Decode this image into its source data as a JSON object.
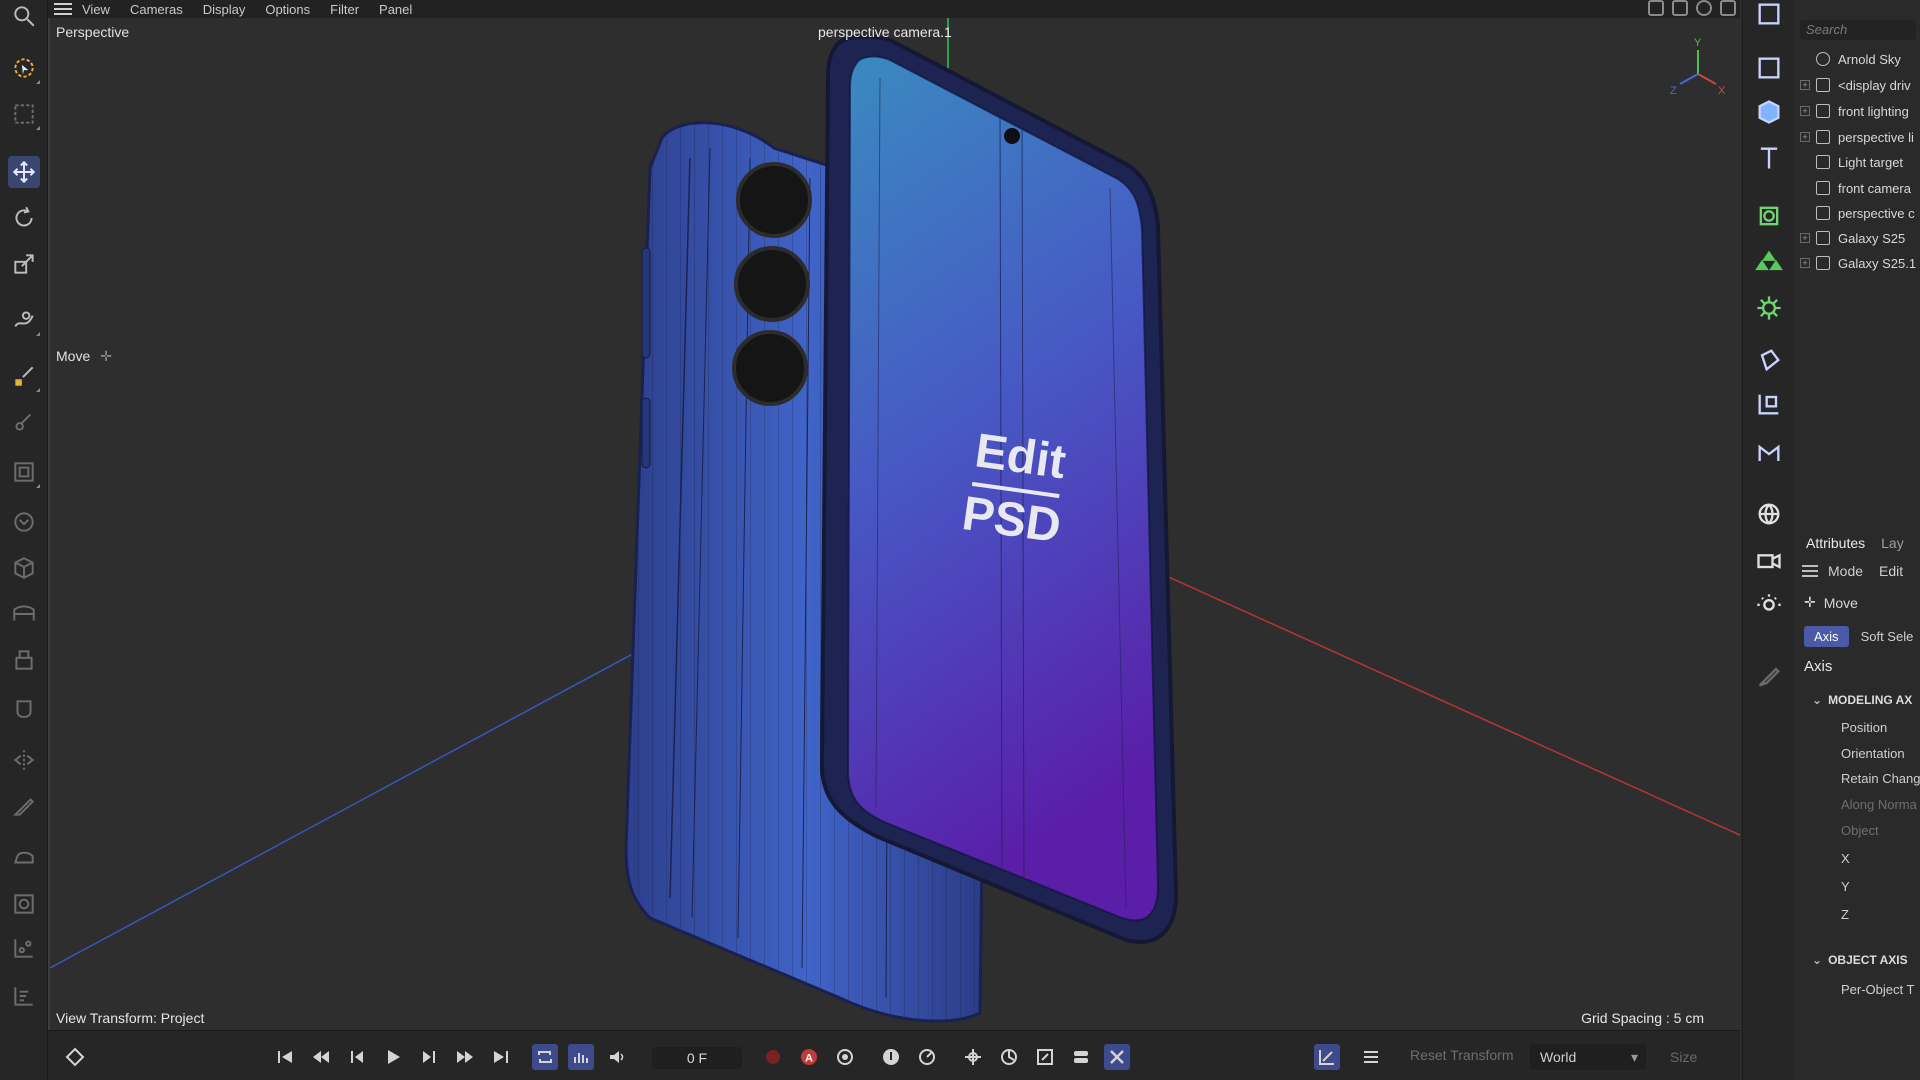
{
  "menu": {
    "items": [
      "View",
      "Cameras",
      "Display",
      "Options",
      "Filter",
      "Panel"
    ]
  },
  "viewport": {
    "label": "Perspective",
    "camera_label": "perspective camera.1",
    "tool_label": "Move",
    "view_transform": "View Transform: Project",
    "grid_spacing": "Grid Spacing : 5 cm",
    "axis_labels": {
      "x": "X",
      "y": "Y",
      "z": "Z"
    },
    "screen_text_line1": "Edit",
    "screen_text_line2": "PSD"
  },
  "object_manager": {
    "search_placeholder": "Search",
    "objects": [
      {
        "label": "Arnold Sky",
        "icon": "globe-icon",
        "expandable": false
      },
      {
        "label": "<display driv",
        "icon": "doc-icon",
        "expandable": true
      },
      {
        "label": "front lighting",
        "icon": "layer-icon",
        "expandable": true
      },
      {
        "label": "perspective li",
        "icon": "layer-icon",
        "expandable": true
      },
      {
        "label": "Light target",
        "icon": "layer-icon",
        "expandable": false
      },
      {
        "label": "front camera",
        "icon": "camera-icon",
        "expandable": false
      },
      {
        "label": "perspective c",
        "icon": "camera-icon",
        "expandable": false
      },
      {
        "label": "Galaxy S25",
        "icon": "layer-icon",
        "expandable": true
      },
      {
        "label": "Galaxy S25.1",
        "icon": "layer-icon",
        "expandable": true
      }
    ]
  },
  "attributes": {
    "tab_active": "Attributes",
    "tab_other": "Lay",
    "mode_label": "Mode",
    "edit_label": "Edit",
    "tool_name": "Move",
    "pill_active": "Axis",
    "pill_other": "Soft Sele",
    "section_title": "Axis",
    "modeling_axis": "MODELING AX",
    "rows": [
      "Position",
      "Orientation",
      "Retain Chang",
      "Along Norma",
      "Object",
      "X",
      "Y",
      "Z"
    ],
    "object_axis": "OBJECT AXIS",
    "per_object": "Per-Object T"
  },
  "timeline": {
    "frame": "0 F",
    "reset_transform": "Reset Transform",
    "coord_space": "World",
    "size_label": "Size"
  },
  "colors": {
    "accent": "#3d4a8c",
    "phone_blue": "#3d63c8",
    "screen_top": "#3a8ac0",
    "screen_bottom": "#5a1ea8",
    "x_axis_line": "#b8333a",
    "z_axis_line": "#3a56b8"
  }
}
